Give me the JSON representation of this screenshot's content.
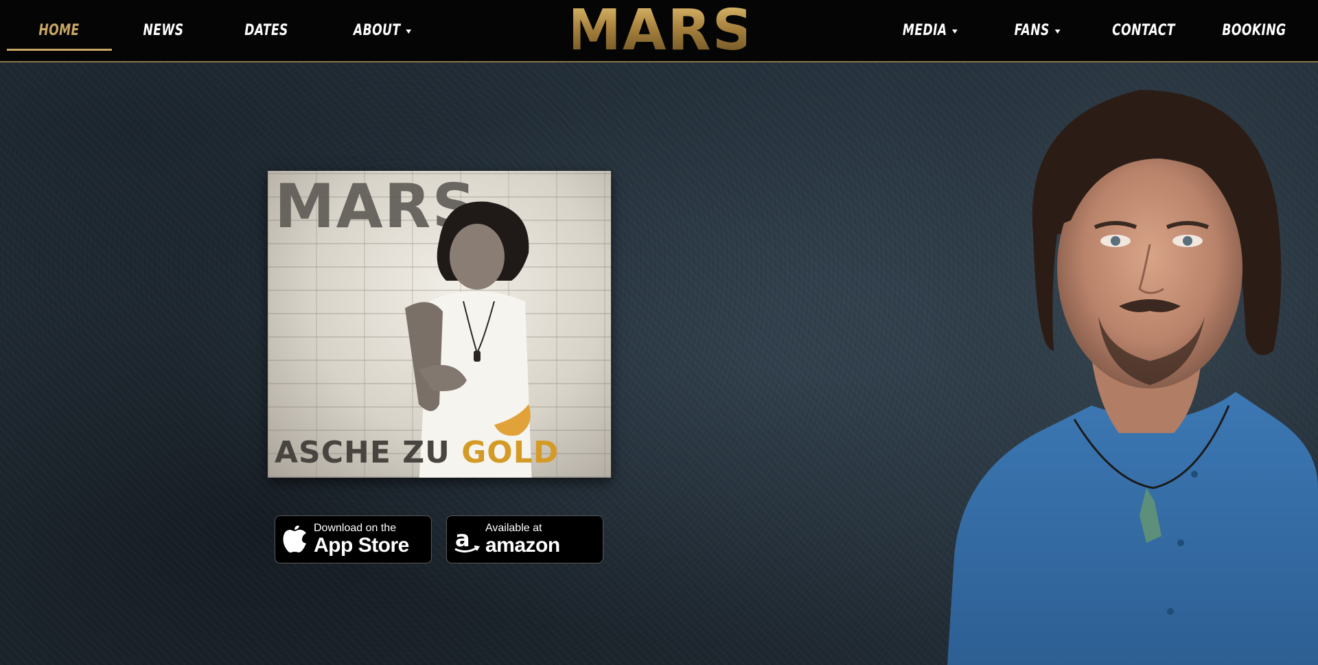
{
  "nav": {
    "left": [
      {
        "label": "HOME",
        "active": true
      },
      {
        "label": "NEWS"
      },
      {
        "label": "DATES"
      },
      {
        "label": "ABOUT"
      }
    ],
    "right": [
      {
        "label": "MEDIA"
      },
      {
        "label": "FANS"
      },
      {
        "label": "CONTACT"
      },
      {
        "label": "BOOKING"
      }
    ],
    "logo_text": "MARS"
  },
  "album": {
    "artist": "MARS",
    "title_part1": "ASCHE ZU ",
    "title_part2": "GOLD"
  },
  "stores": {
    "apple": {
      "line1": "Download on the",
      "line2": "App Store",
      "icon": "apple-icon"
    },
    "amazon": {
      "line1": "Available at",
      "line2": "amazon",
      "icon": "amazon-icon"
    }
  },
  "colors": {
    "accent_gold": "#c9a866",
    "nav_bg": "#050505",
    "page_bg": "#2a3640",
    "shirt_blue": "#3f79b3"
  }
}
